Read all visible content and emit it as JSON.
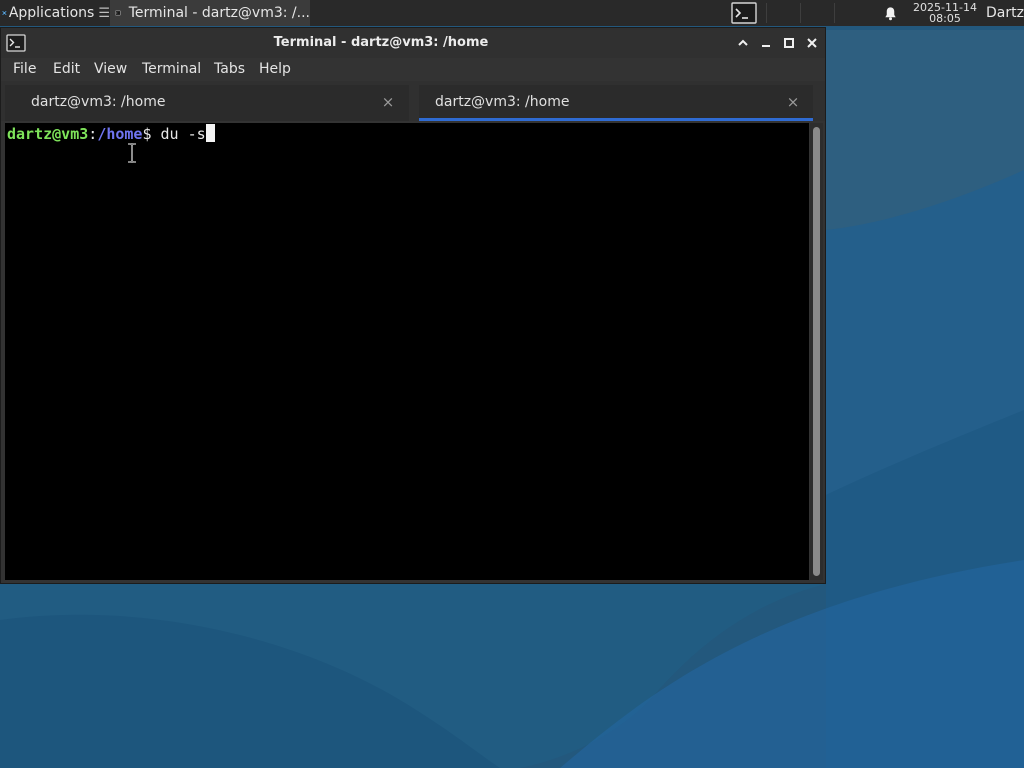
{
  "panel": {
    "apps_label": "Applications",
    "apps_more": "☰",
    "task_label": "Terminal - dartz@vm3: /...",
    "clock_date": "2025-11-14",
    "clock_time": "08:05",
    "user": "Dartz",
    "icons": [
      "xfce-logo-icon",
      "terminal-icon",
      "terminal-icon",
      "bell-icon"
    ]
  },
  "window": {
    "title": "Terminal - dartz@vm3: /home",
    "controls": [
      "chevron-up-icon",
      "minimize-icon",
      "maximize-icon",
      "close-icon"
    ]
  },
  "menu": [
    "File",
    "Edit",
    "View",
    "Terminal",
    "Tabs",
    "Help"
  ],
  "tabs": [
    {
      "label": "dartz@vm3: /home",
      "close": "×",
      "active": false
    },
    {
      "label": "dartz@vm3: /home",
      "close": "×",
      "active": true
    }
  ],
  "terminal": {
    "prompt_user": "dartz@vm3",
    "prompt_colon": ":",
    "prompt_path": "/home",
    "prompt_dollar": "$",
    "command": "du -s"
  },
  "colors": {
    "prompt_user": "#7ee35a",
    "prompt_path": "#6f74f0",
    "active_tab_accent": "#2f6bd2",
    "terminal_bg": "#000000",
    "desktop_bg": "#225a80"
  }
}
